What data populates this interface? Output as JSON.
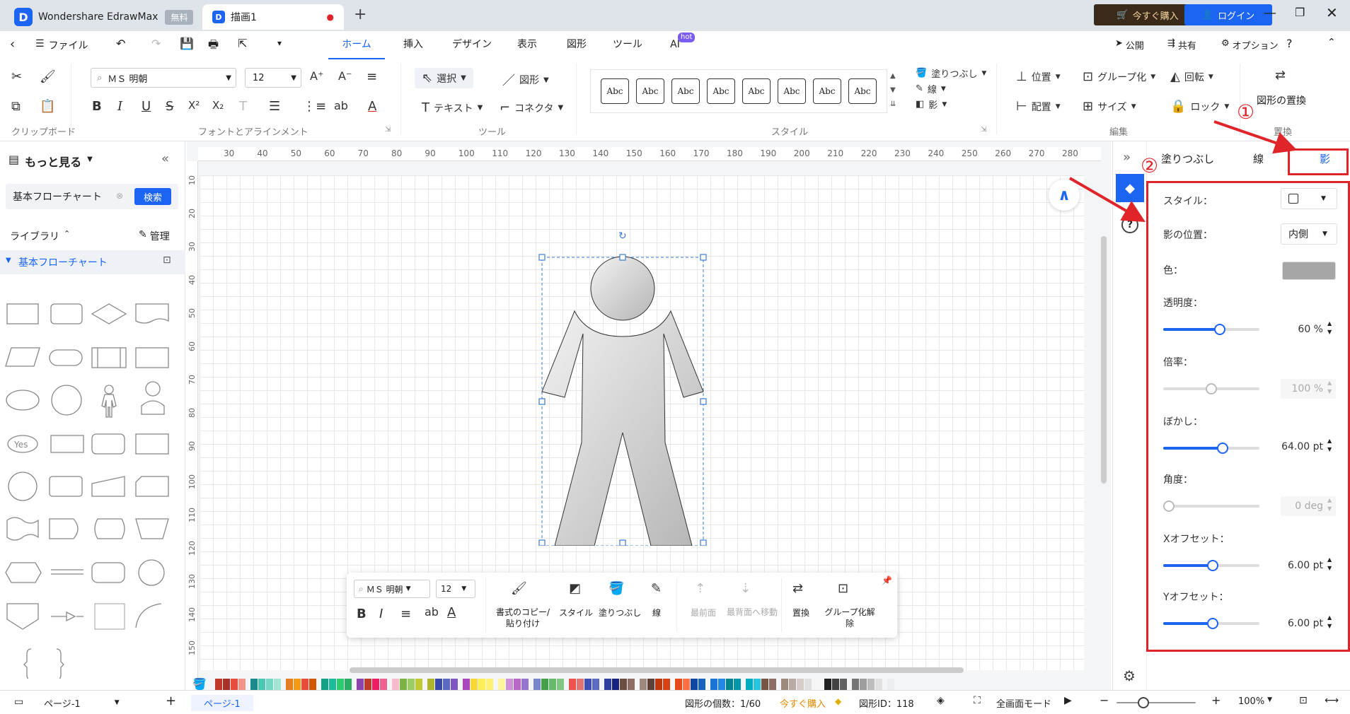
{
  "titlebar": {
    "app_name": "Wondershare EdrawMax",
    "plan_badge": "無料",
    "doc_tab": "描画1",
    "buy_label": "今すぐ購入",
    "login_label": "ログイン"
  },
  "menubar": {
    "file": "ファイル",
    "tabs": [
      "ホーム",
      "挿入",
      "デザイン",
      "表示",
      "図形",
      "ツール",
      "AI"
    ],
    "ai_badge": "hot",
    "publish": "公開",
    "share": "共有",
    "options": "オプション"
  },
  "ribbon": {
    "font_name": "ＭＳ 明朝",
    "font_size": "12",
    "select": "選択",
    "shape": "図形",
    "text": "テキスト",
    "connector": "コネクタ",
    "style_sample": "Abc",
    "fill": "塗りつぶし",
    "line": "線",
    "shadow": "影",
    "position": "位置",
    "group": "グループ化",
    "rotate": "回転",
    "replace_shape": "図形の置換",
    "align": "配置",
    "size": "サイズ",
    "lock": "ロック",
    "groups": {
      "clipboard": "クリップボード",
      "font": "フォントとアラインメント",
      "tools": "ツール",
      "style": "スタイル",
      "edit": "編集",
      "replace": "置換"
    }
  },
  "sidebar": {
    "more": "もっと見る",
    "search_value": "基本フローチャート",
    "search_btn": "検索",
    "library": "ライブラリ",
    "manage": "管理",
    "category": "基本フローチャート",
    "yes_shape": "Yes"
  },
  "ruler": {
    "top": [
      "30",
      "40",
      "50",
      "60",
      "70",
      "80",
      "90",
      "100",
      "110",
      "120",
      "130",
      "140",
      "150",
      "160",
      "170",
      "180",
      "190",
      "200",
      "210",
      "220",
      "230",
      "240",
      "250",
      "260",
      "270",
      "280"
    ],
    "left": [
      "10",
      "20",
      "30",
      "40",
      "50",
      "60",
      "70",
      "80",
      "90",
      "100",
      "110",
      "120",
      "130",
      "140",
      "150"
    ]
  },
  "float_toolbar": {
    "font_name": "ＭＳ 明朝",
    "font_size": "12",
    "format_painter": "書式のコピー/貼り付け",
    "style": "スタイル",
    "fill": "塗りつぶし",
    "line": "線",
    "front": "最前面",
    "back": "最背面へ移動",
    "replace": "置換",
    "ungroup": "グループ化解除"
  },
  "right_panel": {
    "tabs": [
      "塗りつぶし",
      "線",
      "影"
    ],
    "annot1": "①",
    "annot2": "②",
    "props": {
      "style_label": "スタイル：",
      "position_label": "影の位置：",
      "position_value": "内側",
      "color_label": "色：",
      "color_value": "#a6a6a6",
      "transparency_label": "透明度：",
      "transparency_value": "60 %",
      "transparency_level": 0.6,
      "scale_label": "倍率：",
      "scale_value": "100 %",
      "blur_label": "ぼかし：",
      "blur_value": "64.00 pt",
      "angle_label": "角度：",
      "angle_value": "0 deg",
      "xoffset_label": "Xオフセット：",
      "xoffset_value": "6.00 pt",
      "yoffset_label": "Yオフセット：",
      "yoffset_value": "6.00 pt"
    }
  },
  "statusbar": {
    "page_selector": "ページ-1",
    "page_tab": "ページ-1",
    "shape_count": "図形の個数：1/60",
    "buy": "今すぐ購入",
    "shape_id": "図形ID：118",
    "fullscreen": "全画面モード",
    "zoom": "100%"
  },
  "palette": [
    "#c0392b",
    "#a93226",
    "#e74c3c",
    "#f1948a",
    "#1a8a8a",
    "#48c9b0",
    "#76d7c4",
    "#a3e4d7",
    "#e67e22",
    "#f39c12",
    "#e74c3c",
    "#d35400",
    "#16a085",
    "#1abc9c",
    "#2ecc71",
    "#27ae60",
    "#8e44ad",
    "#c0392b",
    "#e91e63",
    "#f06292",
    "#f8bbd0",
    "#7cb342",
    "#9ccc65",
    "#c0ca33",
    "#afb42b",
    "#3949ab",
    "#5c6bc0",
    "#7e57c2",
    "#ab47bc",
    "#fdd835",
    "#ffee58",
    "#fff176",
    "#fff59d",
    "#ce93d8",
    "#ba68c8",
    "#9575cd",
    "#7986cb",
    "#43a047",
    "#66bb6a",
    "#81c784",
    "#ef5350",
    "#e57373",
    "#3f51b5",
    "#5c6bc0",
    "#303f9f",
    "#1a237e",
    "#6d4c41",
    "#8d6e63",
    "#a1887f",
    "#5d4037",
    "#bf360c",
    "#d84315",
    "#e64a19",
    "#ff7043",
    "#0d47a1",
    "#1565c0",
    "#1976d2",
    "#1e88e5",
    "#00838f",
    "#0097a7",
    "#00acc1",
    "#26c6da",
    "#795548",
    "#8d6e63",
    "#a1887f",
    "#bcaaa4",
    "#d7ccc8",
    "#e0e0e0",
    "#f5f5f5",
    "#212121",
    "#424242",
    "#616161",
    "#757575",
    "#9e9e9e",
    "#bdbdbd",
    "#e0e0e0",
    "#eeeeee"
  ]
}
